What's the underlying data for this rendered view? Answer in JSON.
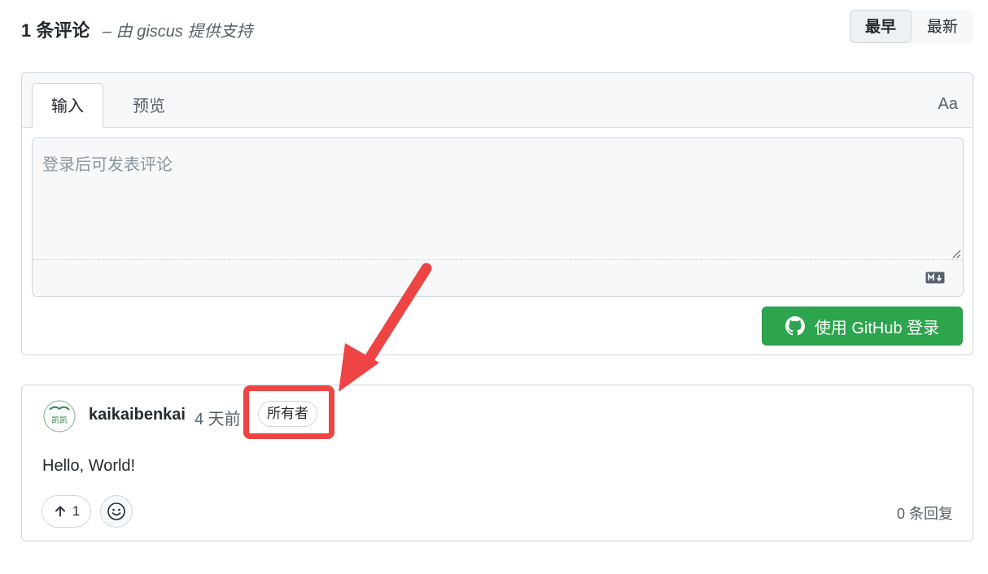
{
  "header": {
    "count": "1 条评论",
    "powered_by": "– 由 giscus 提供支持",
    "sort": {
      "oldest": "最早",
      "newest": "最新"
    }
  },
  "editor": {
    "tabs": {
      "write": "输入",
      "preview": "预览"
    },
    "format_toggle": "Aa",
    "placeholder": "登录后可发表评论",
    "login_button": "使用 GitHub 登录"
  },
  "comment": {
    "author": "kaikaibenkai",
    "time": "4 天前",
    "badge": "所有者",
    "body": "Hello, World!",
    "upvotes": "1",
    "replies": "0 条回复",
    "avatar_text": "凯凯"
  },
  "colors": {
    "accent_green": "#2da44e",
    "annotation_red": "#ef4444",
    "border": "#d0d7de"
  }
}
